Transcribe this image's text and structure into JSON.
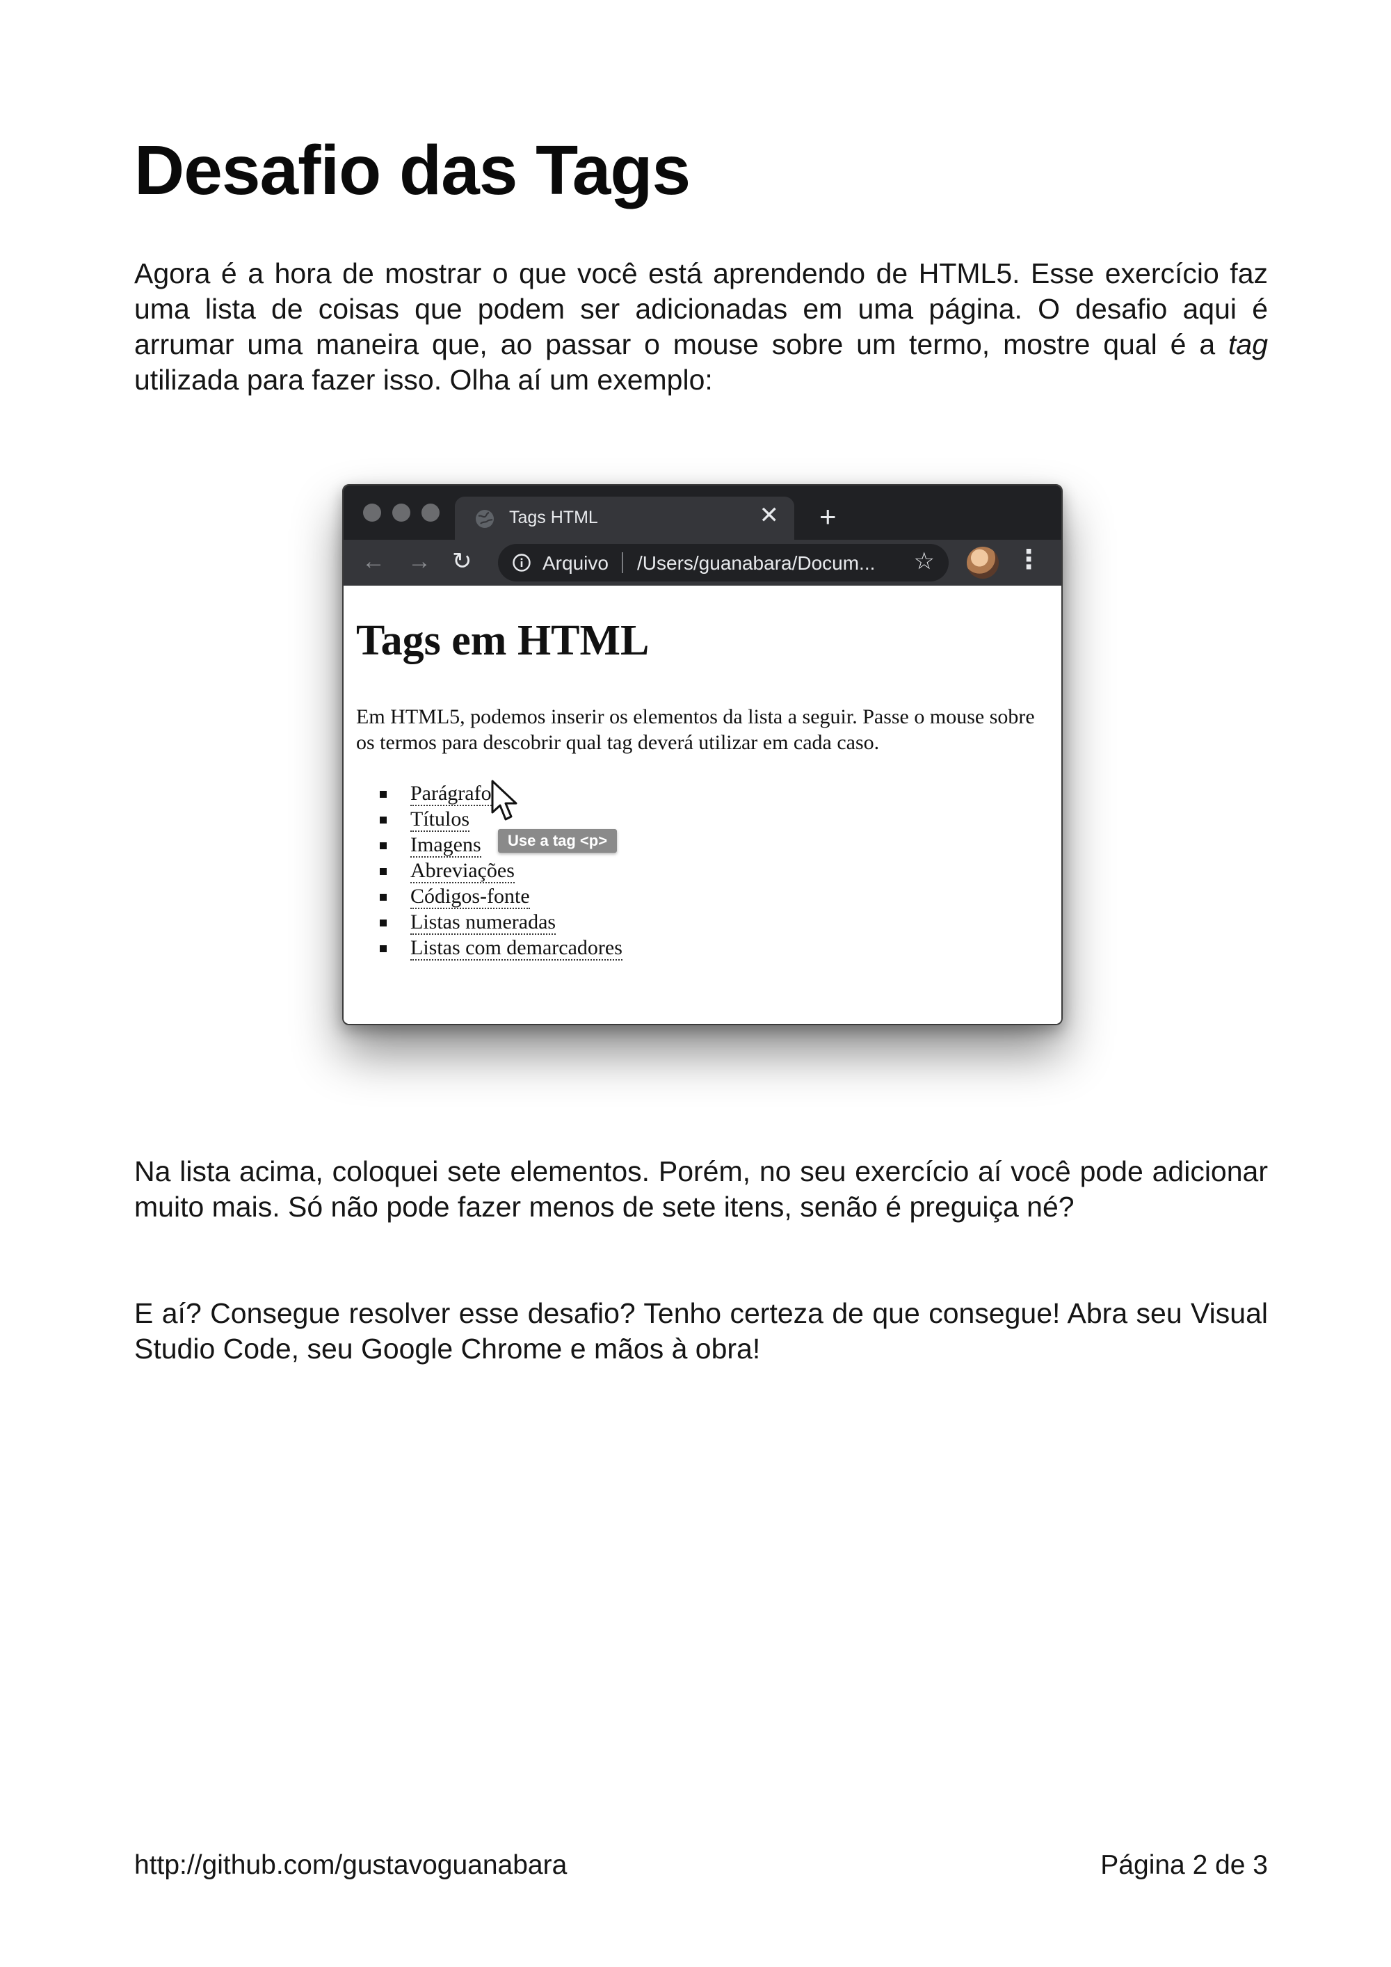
{
  "title": "Desafio das Tags",
  "intro": {
    "before_tag": "Agora é a hora de mostrar o que você está aprendendo de HTML5. Esse exercício faz uma lista de coisas que podem ser adicionadas em uma página. O desafio aqui é arrumar uma maneira que, ao passar o mouse sobre um termo, mostre qual é a ",
    "tag_word": "tag",
    "after_tag": " utilizada para fazer isso. Olha aí um exemplo:"
  },
  "screenshot": {
    "tab_title": "Tags HTML",
    "tab_close": "✕",
    "new_tab": "+",
    "site_label": "Arquivo",
    "url": "/Users/guanabara/Docum...",
    "page_heading": "Tags em HTML",
    "page_paragraph": "Em HTML5, podemos inserir os elementos da lista a seguir. Passe o mouse sobre os termos para descobrir qual tag deverá utilizar em cada caso.",
    "list_items": [
      "Parágrafos",
      "Títulos",
      "Imagens",
      "Abreviações",
      "Códigos-fonte",
      "Listas numeradas",
      "Listas com demarcadores"
    ],
    "tooltip": "Use a tag <p>",
    "icons": [
      "globe-icon",
      "close-icon",
      "plus-icon",
      "back-arrow-icon",
      "forward-arrow-icon",
      "reload-icon",
      "info-icon",
      "star-icon",
      "avatar",
      "more-vert-icon",
      "mouse-cursor-icon"
    ]
  },
  "paragraph2": "Na lista acima, coloquei sete elementos. Porém, no seu exercício aí você pode adicionar muito mais. Só não pode fazer menos de sete itens, senão é preguiça né?",
  "paragraph3": "E aí? Consegue resolver esse desafio? Tenho certeza de que consegue! Abra seu Visual Studio Code, seu Google Chrome e mãos à obra!",
  "footer": {
    "link": "http://github.com/gustavoguanabara",
    "page": "Página 2 de 3"
  }
}
